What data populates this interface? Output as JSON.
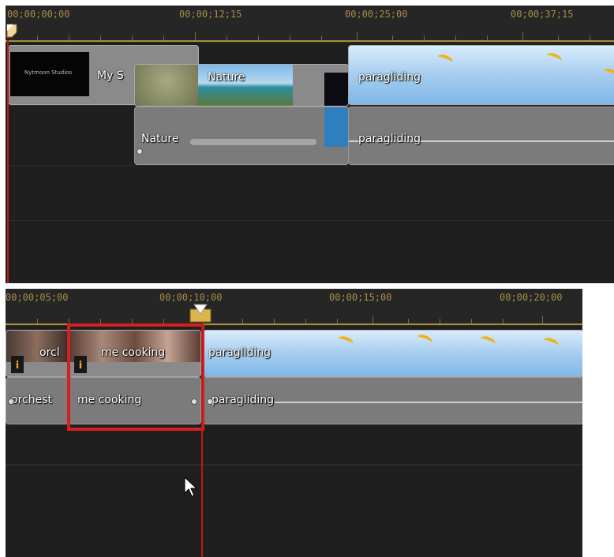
{
  "top": {
    "timecodes": [
      "00;00;00;00",
      "00;00;12;15",
      "00;00;25;00",
      "00;00;37;15"
    ],
    "video_clips": {
      "title_text": "My S",
      "title_card": "Nytmoon Studios",
      "nature": "Nature",
      "paragliding": "paragliding"
    },
    "audio_clips": {
      "nature": "Nature",
      "paragliding": "paragliding"
    }
  },
  "bottom": {
    "timecodes": [
      "00;00;05;00",
      "00;00;10;00",
      "00;00;15;00",
      "00;00;20;00"
    ],
    "video_clips": {
      "orchestra": "orcl",
      "cooking": "me cooking",
      "paragliding": "paragliding"
    },
    "audio_clips": {
      "orchestra": "orchest",
      "cooking": "me cooking",
      "paragliding": "paragliding"
    },
    "info_icon": "i",
    "selection_color": "#d42020"
  },
  "colors": {
    "timeline_bg": "#1f1f1f",
    "ruler_text": "#a88c46",
    "playhead": "#c01818"
  },
  "icons": [
    "playhead-marker-icon",
    "info-icon",
    "mouse-cursor-icon"
  ]
}
